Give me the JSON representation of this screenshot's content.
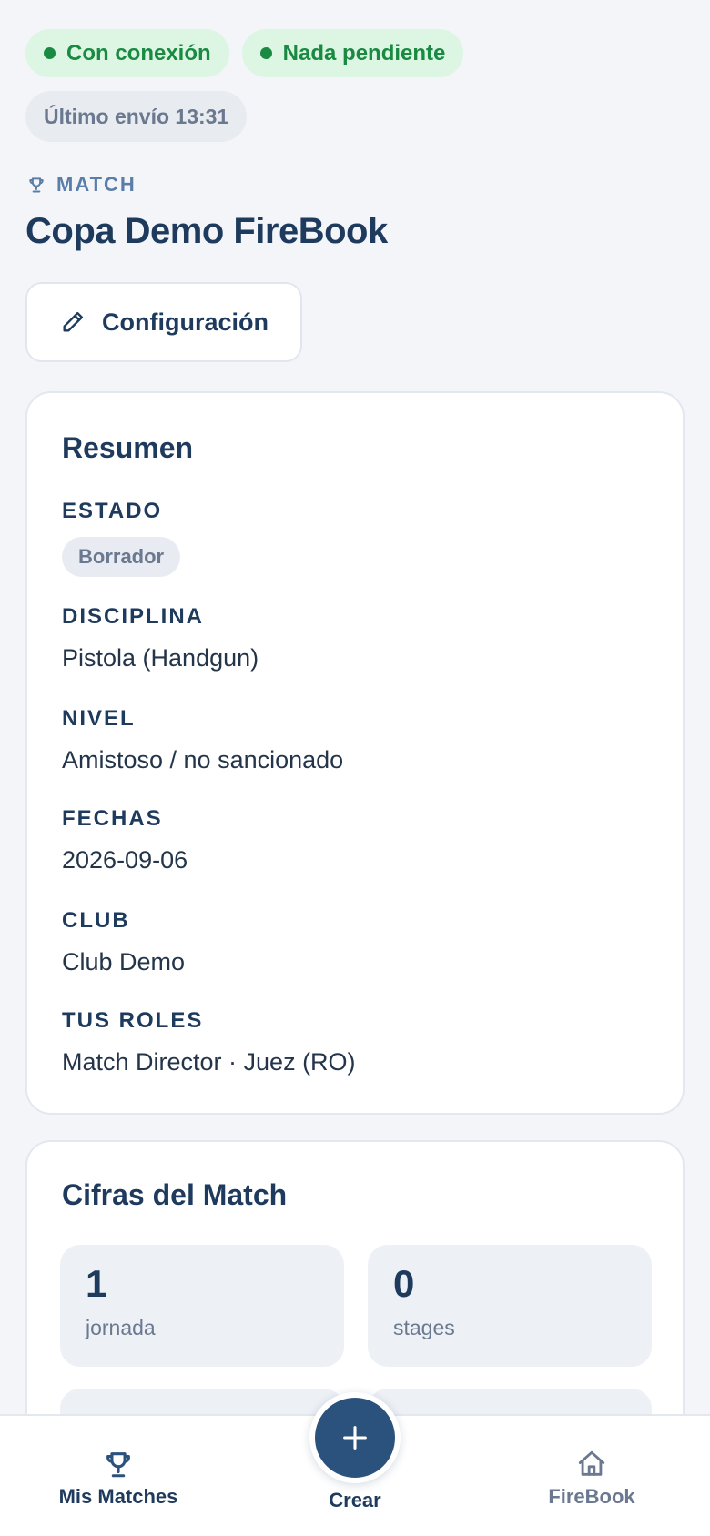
{
  "status": {
    "connection": "Con conexión",
    "pending": "Nada pendiente",
    "last_sent": "Último envío 13:31"
  },
  "header": {
    "eyebrow": "MATCH",
    "eyebrow_icon": "trophy-icon",
    "title": "Copa Demo FireBook",
    "config_button": "Configuración",
    "config_icon": "pencil-icon"
  },
  "summary": {
    "title": "Resumen",
    "fields": [
      {
        "label": "ESTADO",
        "value": "Borrador"
      },
      {
        "label": "DISCIPLINA",
        "value": "Pistola (Handgun)"
      },
      {
        "label": "NIVEL",
        "value": "Amistoso / no sancionado"
      },
      {
        "label": "FECHAS",
        "value": "2026-09-06"
      },
      {
        "label": "CLUB",
        "value": "Club Demo"
      },
      {
        "label": "TUS ROLES",
        "value": "Match Director · Juez (RO)"
      }
    ]
  },
  "figures": {
    "title": "Cifras del Match",
    "stats": [
      {
        "value": "1",
        "label": "jornada"
      },
      {
        "value": "0",
        "label": "stages"
      }
    ]
  },
  "nav": {
    "items": [
      {
        "label": "Mis Matches",
        "icon": "trophy-icon"
      },
      {
        "label": "Crear",
        "icon": "plus-icon"
      },
      {
        "label": "FireBook",
        "icon": "home-icon"
      }
    ]
  },
  "colors": {
    "primary": "#1e3a5c",
    "accent": "#2b527c",
    "success": "#1a8a42",
    "success_bg": "#dcf6e3",
    "muted": "#6a7890"
  }
}
